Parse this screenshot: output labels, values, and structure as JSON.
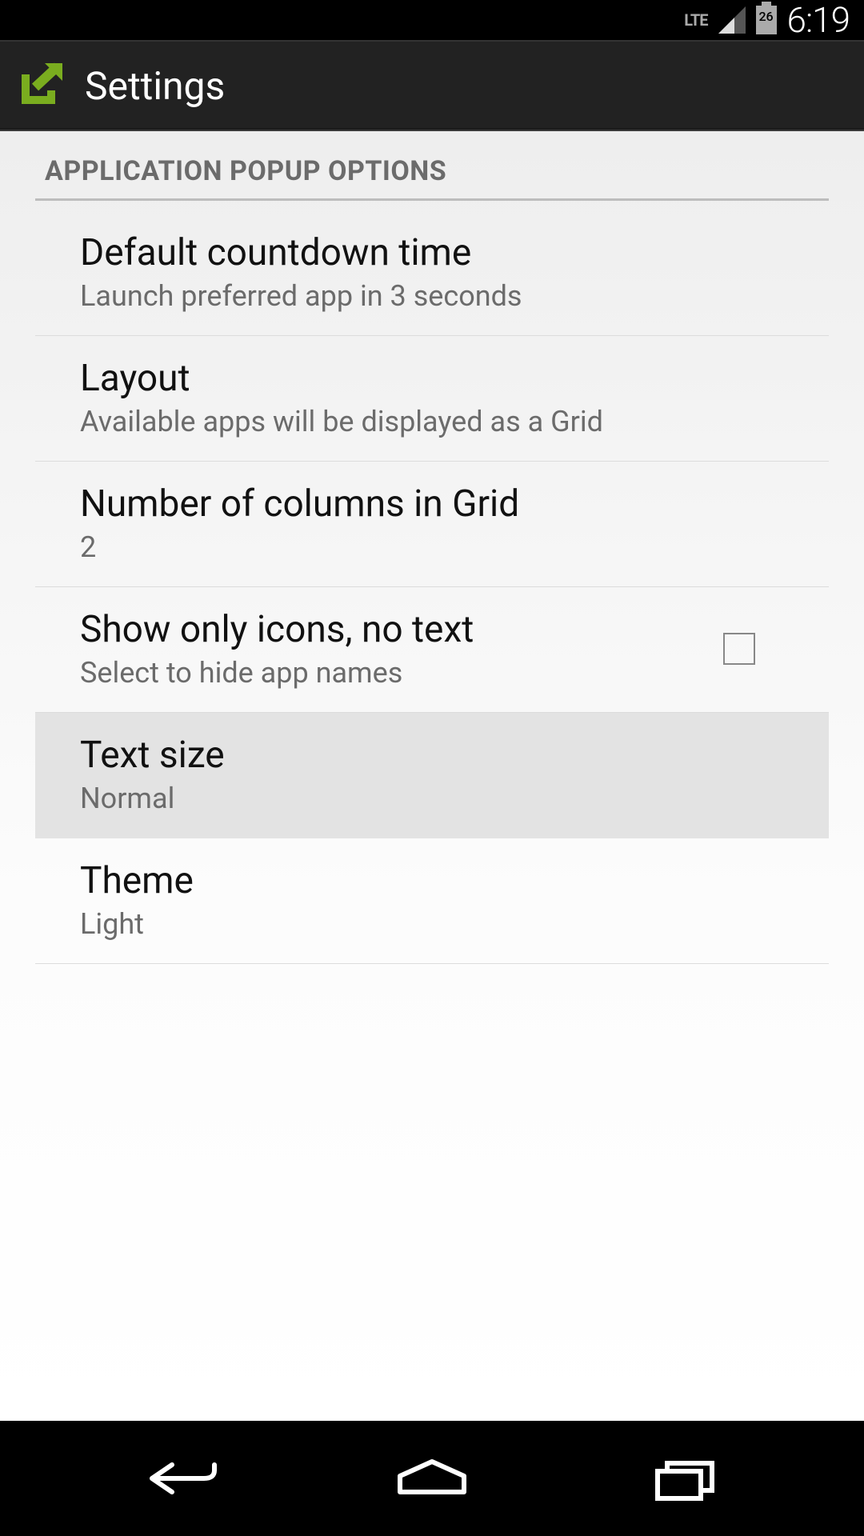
{
  "status_bar": {
    "network": "LTE",
    "battery_pct": "26",
    "time": "6:19"
  },
  "action_bar": {
    "title": "Settings"
  },
  "section": {
    "header": "APPLICATION POPUP OPTIONS",
    "items": [
      {
        "title": "Default countdown time",
        "subtitle": "Launch preferred app in 3 seconds"
      },
      {
        "title": "Layout",
        "subtitle": "Available apps will be displayed as a Grid"
      },
      {
        "title": "Number of columns in Grid",
        "subtitle": "2"
      },
      {
        "title": "Show only icons, no text",
        "subtitle": "Select to hide app names",
        "checked": false
      },
      {
        "title": "Text size",
        "subtitle": "Normal",
        "highlighted": true
      },
      {
        "title": "Theme",
        "subtitle": "Light"
      }
    ]
  }
}
